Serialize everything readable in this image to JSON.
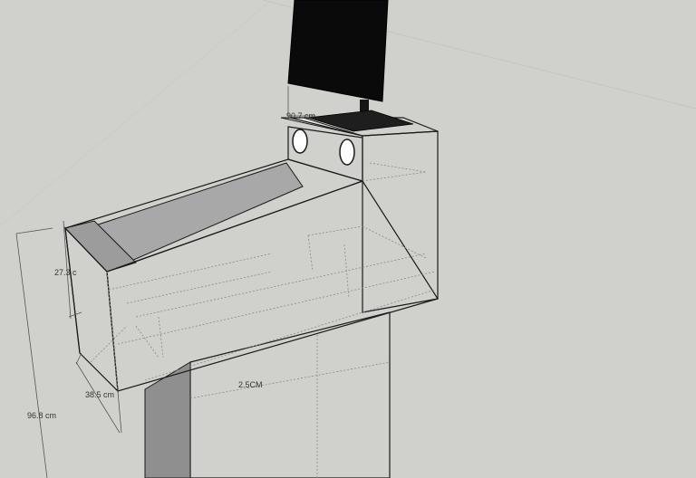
{
  "colors": {
    "background": "#d0d0cc",
    "panel_face": "#f4f4f2",
    "top_surface": "#a8a8a8",
    "monitor": "#0a0a0a",
    "grid_line": "#bdbdb8"
  },
  "dimensions": {
    "monitor_width_label": "90.7 cm",
    "side_depth_label": "27.3 c",
    "bottom_depth_label": "38.5 cm",
    "total_height_label": "96.8 cm",
    "pedestal_label": "2.5CM"
  },
  "icons": {
    "speaker_left": "speaker-hole-icon",
    "speaker_right": "speaker-hole-icon"
  }
}
